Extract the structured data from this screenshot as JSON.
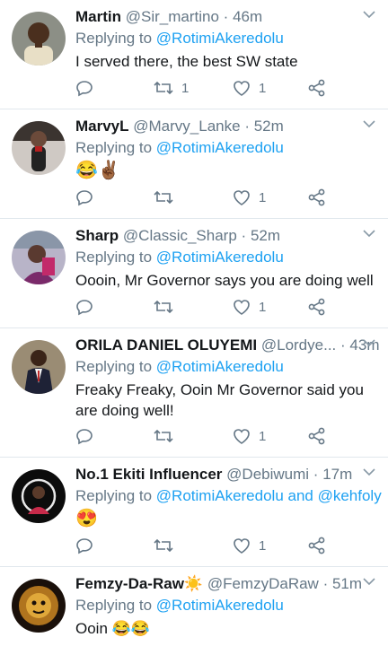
{
  "tweets": [
    {
      "name": "Martin",
      "handle": "@Sir_martino",
      "time": "46m",
      "reply_prefix": "Replying to",
      "reply_to": "@RotimiAkeredolu",
      "text": "I served there, the best SW state",
      "retweets": "1",
      "likes": "1",
      "avatar_color": "#7a5a3a"
    },
    {
      "name": "MarvyL",
      "handle": "@Marvy_Lanke",
      "time": "52m",
      "reply_prefix": "Replying to",
      "reply_to": "@RotimiAkeredolu",
      "text": "😂✌🏾",
      "retweets": "",
      "likes": "1",
      "avatar_color": "#5a4a44"
    },
    {
      "name": "Sharp",
      "handle": "@Classic_Sharp",
      "time": "52m",
      "reply_prefix": "Replying to",
      "reply_to": "@RotimiAkeredolu",
      "text": "Oooin, Mr Governor says you are doing well",
      "retweets": "",
      "likes": "1",
      "avatar_color": "#6f6a8a"
    },
    {
      "name": "ORILA DANIEL OLUYEMI",
      "handle": "@Lordye...",
      "time": "43m",
      "reply_prefix": "Replying to",
      "reply_to": "@RotimiAkeredolu",
      "text": "Freaky Freaky, Ooin Mr Governor said you are doing well!",
      "retweets": "",
      "likes": "1",
      "avatar_color": "#3a3b48"
    },
    {
      "name": "No.1 Ekiti Influencer",
      "handle": "@Debiwumi",
      "time": "17m",
      "reply_prefix": "Replying to",
      "reply_to": "@RotimiAkeredolu and @kehfoly",
      "text": "😍",
      "retweets": "",
      "likes": "1",
      "avatar_color": "#111111"
    },
    {
      "name": "Femzy-Da-Raw☀️",
      "handle": "@FemzyDaRaw",
      "time": "51m",
      "reply_prefix": "Replying to",
      "reply_to": "@RotimiAkeredolu",
      "text": "Ooin 😂😂",
      "retweets": "",
      "likes": "",
      "avatar_color": "#2a1a10"
    }
  ],
  "colors": {
    "link": "#1da1f2",
    "muted": "#657786",
    "divider": "#e1e8ed"
  }
}
